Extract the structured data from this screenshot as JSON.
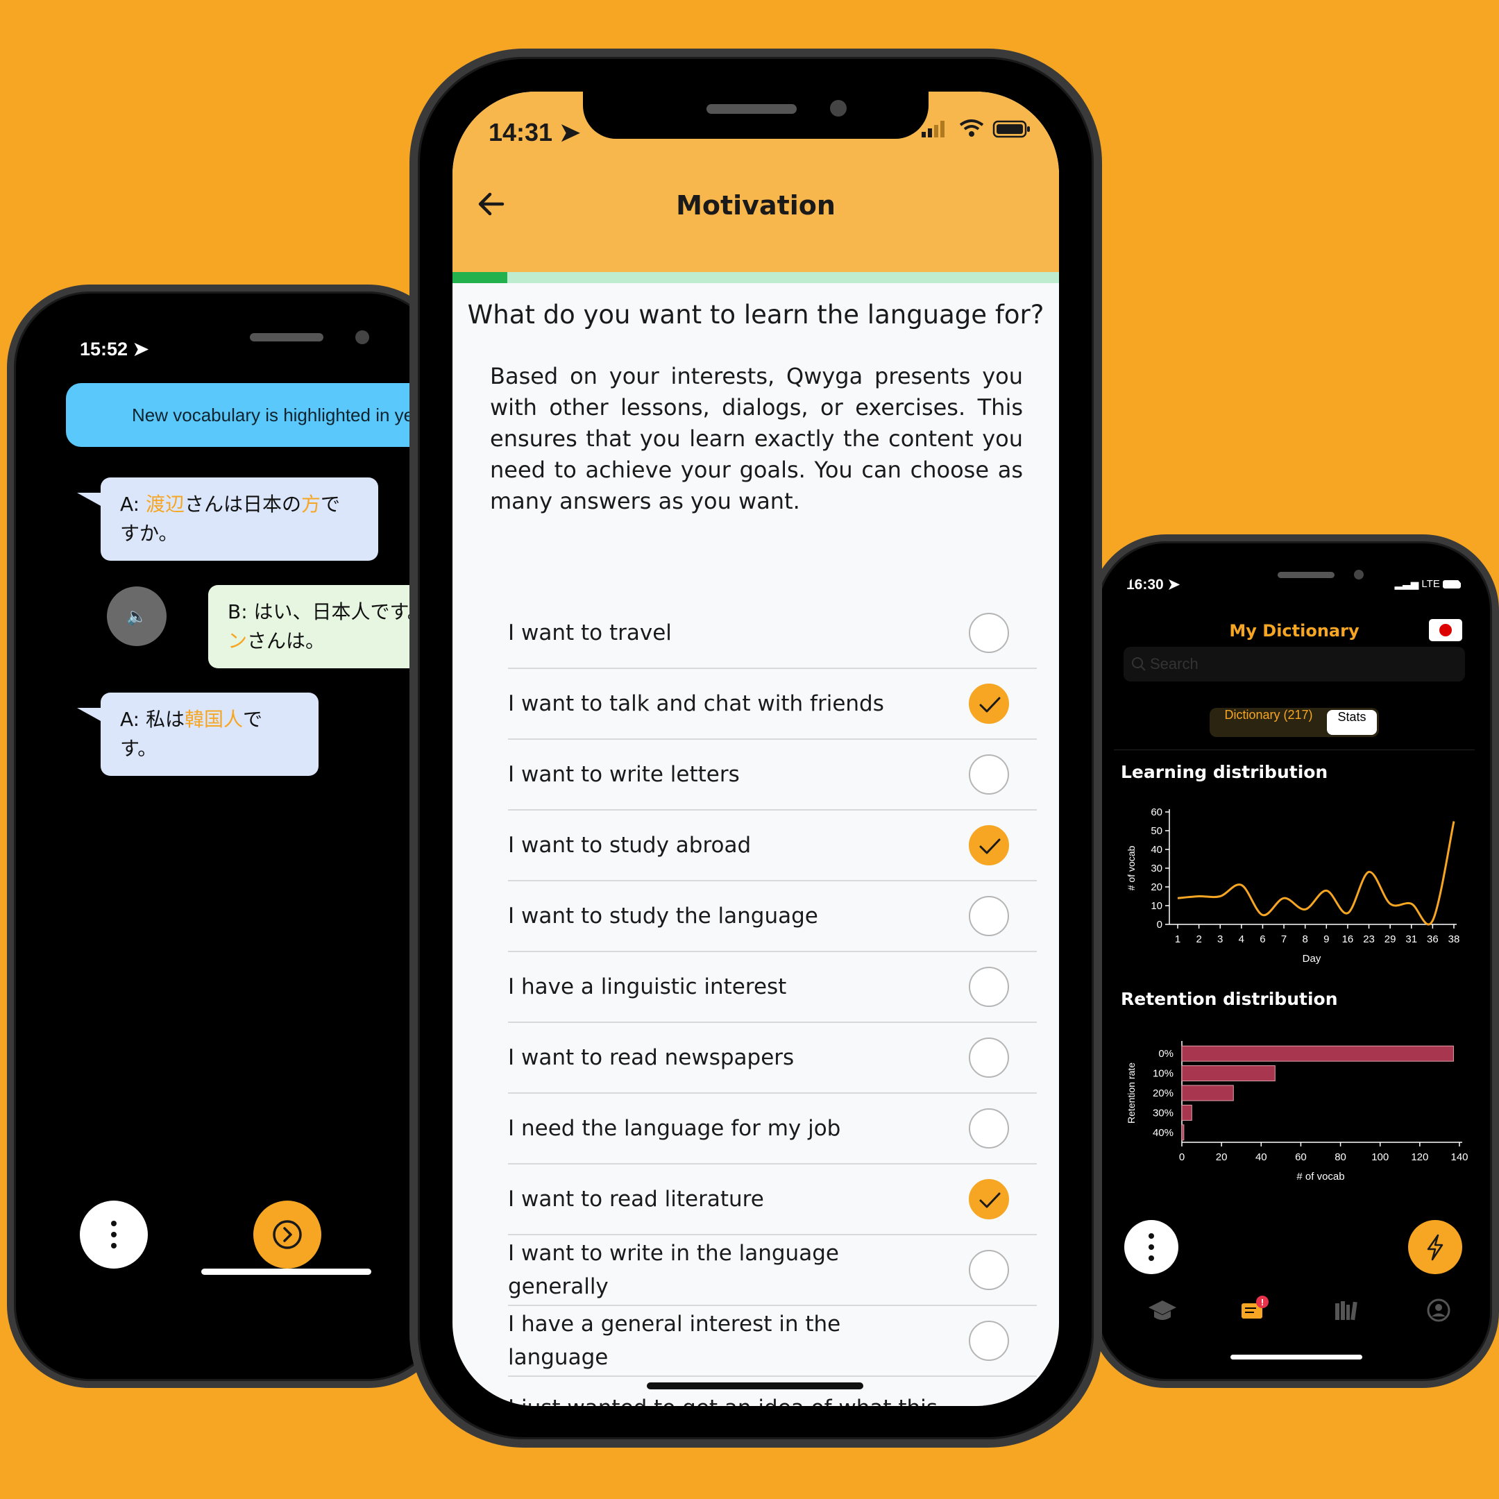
{
  "left_phone": {
    "time": "15:52",
    "banner": "New vocabulary is highlighted in ye",
    "bubbles": {
      "a1_prefix": "A: ",
      "a1_hl1": "渡辺",
      "a1_mid": "さんは日本の",
      "a1_hl2": "方",
      "a1_suffix": "ですか。",
      "b1_line1": "B: はい、日本人です。",
      "b1_hl": "ン",
      "b1_line2": "さんは。",
      "a2_prefix": "A: 私は",
      "a2_hl": "韓国人",
      "a2_suffix": "です。"
    }
  },
  "center_phone": {
    "time": "14:31",
    "title": "Motivation",
    "progress": 0.09,
    "question": "What do you want to learn the language for?",
    "intro": "Based on your interests, Qwyga presents you with other lessons, dialogs, or exercises. This ensures that you learn exactly the content you need to achieve your goals. You can choose as many answers as you want.",
    "options": [
      {
        "label": "I want to travel",
        "checked": false
      },
      {
        "label": "I want to talk and chat with friends",
        "checked": true
      },
      {
        "label": "I want to write letters",
        "checked": false
      },
      {
        "label": "I want to study abroad",
        "checked": true
      },
      {
        "label": "I want to study the language",
        "checked": false
      },
      {
        "label": "I have a linguistic interest",
        "checked": false
      },
      {
        "label": "I want to read newspapers",
        "checked": false
      },
      {
        "label": "I need the language for my job",
        "checked": false
      },
      {
        "label": "I want to read literature",
        "checked": true
      },
      {
        "label": "I want to write in the language generally",
        "checked": false
      },
      {
        "label": "I have a general interest in the language",
        "checked": false
      },
      {
        "label": "I just wanted to get an idea of what this language is about",
        "checked": false
      }
    ]
  },
  "right_phone": {
    "time": "16:30",
    "network": "LTE",
    "title": "My Dictionary",
    "search_placeholder": "Search",
    "segment_dictionary": "Dictionary (217)",
    "segment_stats": "Stats",
    "learning_title": "Learning distribution",
    "retention_title": "Retention distribution"
  },
  "chart_data": [
    {
      "type": "line",
      "title": "Learning distribution",
      "xlabel": "Day",
      "ylabel": "# of vocab",
      "categories": [
        "1",
        "2",
        "3",
        "4",
        "6",
        "7",
        "8",
        "9",
        "16",
        "23",
        "29",
        "31",
        "36",
        "38"
      ],
      "values": [
        14,
        15,
        15,
        21,
        5,
        14,
        8,
        18,
        6,
        28,
        11,
        11,
        2,
        55
      ],
      "yticks": [
        0,
        10,
        20,
        30,
        40,
        50,
        60
      ],
      "ylim": [
        0,
        60
      ],
      "color": "#F6A623"
    },
    {
      "type": "bar",
      "orientation": "horizontal",
      "title": "Retention distribution",
      "xlabel": "# of vocab",
      "ylabel": "Retention rate",
      "categories": [
        "0%",
        "10%",
        "20%",
        "30%",
        "40%"
      ],
      "values": [
        137,
        47,
        26,
        5,
        1
      ],
      "xticks": [
        0,
        20,
        40,
        60,
        80,
        100,
        120,
        140
      ],
      "xlim": [
        0,
        140
      ],
      "color": "#A8364E"
    }
  ]
}
